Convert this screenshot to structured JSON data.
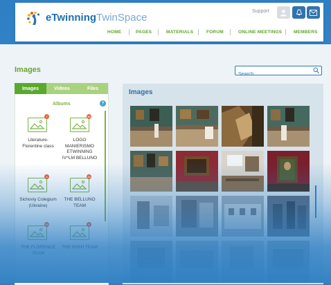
{
  "header": {
    "brand_part1": "e",
    "brand_part2": "Twinning",
    "brand_part3": "TwinSpace",
    "support_label": "Support",
    "nav": [
      "HOME",
      "PAGES",
      "MATERIALS",
      "FORUM",
      "ONLINE MEETINGS",
      "MEMBERS"
    ]
  },
  "page": {
    "title": "Images",
    "search_placeholder": "Search"
  },
  "left": {
    "tabs": [
      "Images",
      "Videos",
      "Files"
    ],
    "active_tab": "Images",
    "albums_title": "Albums",
    "help_label": "?",
    "albums": [
      {
        "name": "Literature-Florentine class",
        "badge": "7"
      },
      {
        "name": "LOGO MANIERISMO ETWINNING IV^LM BELLUNO",
        "badge": "10"
      },
      {
        "name": "Sichoviy Colegium (Ukraine)",
        "badge": "4"
      },
      {
        "name": "THE BELLUNO TEAM",
        "badge": "22"
      },
      {
        "name": "THE FLORENCE TEAM",
        "badge": "20"
      },
      {
        "name": "THE IRISH TEAM",
        "badge": "8"
      }
    ]
  },
  "grid": {
    "title": "Images"
  },
  "colors": {
    "brand_blue": "#1e6fb0",
    "accent_green": "#5ba82e",
    "badge_orange": "#e8603a",
    "bg_blue": "#2e7fc3"
  }
}
